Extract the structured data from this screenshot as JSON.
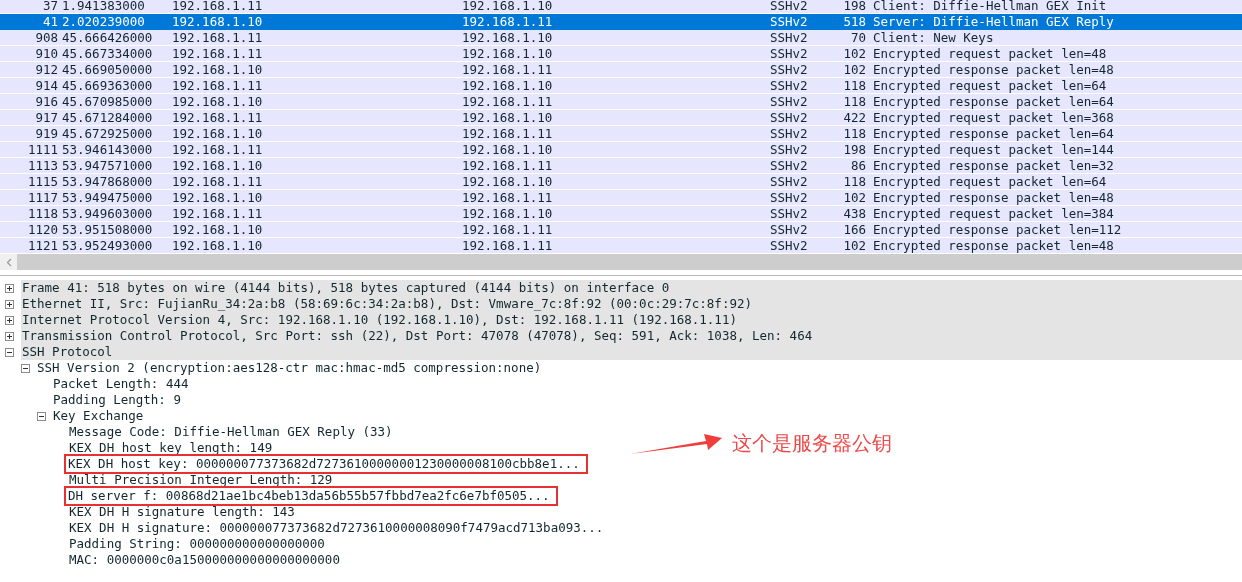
{
  "packet_list": {
    "rows": [
      {
        "no": "37",
        "time": "1.941383000",
        "source": "192.168.1.11",
        "destination": "192.168.1.10",
        "protocol": "SSHv2",
        "length": "198",
        "info": "Client: Diffie-Hellman GEX Init",
        "selected": false
      },
      {
        "no": "41",
        "time": "2.020239000",
        "source": "192.168.1.10",
        "destination": "192.168.1.11",
        "protocol": "SSHv2",
        "length": "518",
        "info": "Server: Diffie-Hellman GEX Reply",
        "selected": true
      },
      {
        "no": "908",
        "time": "45.666426000",
        "source": "192.168.1.11",
        "destination": "192.168.1.10",
        "protocol": "SSHv2",
        "length": "70",
        "info": "Client: New Keys",
        "selected": false
      },
      {
        "no": "910",
        "time": "45.667334000",
        "source": "192.168.1.11",
        "destination": "192.168.1.10",
        "protocol": "SSHv2",
        "length": "102",
        "info": "Encrypted request packet len=48",
        "selected": false
      },
      {
        "no": "912",
        "time": "45.669050000",
        "source": "192.168.1.10",
        "destination": "192.168.1.11",
        "protocol": "SSHv2",
        "length": "102",
        "info": "Encrypted response packet len=48",
        "selected": false
      },
      {
        "no": "914",
        "time": "45.669363000",
        "source": "192.168.1.11",
        "destination": "192.168.1.10",
        "protocol": "SSHv2",
        "length": "118",
        "info": "Encrypted request packet len=64",
        "selected": false
      },
      {
        "no": "916",
        "time": "45.670985000",
        "source": "192.168.1.10",
        "destination": "192.168.1.11",
        "protocol": "SSHv2",
        "length": "118",
        "info": "Encrypted response packet len=64",
        "selected": false
      },
      {
        "no": "917",
        "time": "45.671284000",
        "source": "192.168.1.11",
        "destination": "192.168.1.10",
        "protocol": "SSHv2",
        "length": "422",
        "info": "Encrypted request packet len=368",
        "selected": false
      },
      {
        "no": "919",
        "time": "45.672925000",
        "source": "192.168.1.10",
        "destination": "192.168.1.11",
        "protocol": "SSHv2",
        "length": "118",
        "info": "Encrypted response packet len=64",
        "selected": false
      },
      {
        "no": "1111",
        "time": "53.946143000",
        "source": "192.168.1.11",
        "destination": "192.168.1.10",
        "protocol": "SSHv2",
        "length": "198",
        "info": "Encrypted request packet len=144",
        "selected": false
      },
      {
        "no": "1113",
        "time": "53.947571000",
        "source": "192.168.1.10",
        "destination": "192.168.1.11",
        "protocol": "SSHv2",
        "length": "86",
        "info": "Encrypted response packet len=32",
        "selected": false
      },
      {
        "no": "1115",
        "time": "53.947868000",
        "source": "192.168.1.11",
        "destination": "192.168.1.10",
        "protocol": "SSHv2",
        "length": "118",
        "info": "Encrypted request packet len=64",
        "selected": false
      },
      {
        "no": "1117",
        "time": "53.949475000",
        "source": "192.168.1.10",
        "destination": "192.168.1.11",
        "protocol": "SSHv2",
        "length": "102",
        "info": "Encrypted response packet len=48",
        "selected": false
      },
      {
        "no": "1118",
        "time": "53.949603000",
        "source": "192.168.1.11",
        "destination": "192.168.1.10",
        "protocol": "SSHv2",
        "length": "438",
        "info": "Encrypted request packet len=384",
        "selected": false
      },
      {
        "no": "1120",
        "time": "53.951508000",
        "source": "192.168.1.10",
        "destination": "192.168.1.11",
        "protocol": "SSHv2",
        "length": "166",
        "info": "Encrypted response packet len=112",
        "selected": false
      },
      {
        "no": "1121",
        "time": "53.952493000",
        "source": "192.168.1.10",
        "destination": "192.168.1.11",
        "protocol": "SSHv2",
        "length": "102",
        "info": "Encrypted response packet len=48",
        "selected": false
      }
    ]
  },
  "packet_details": [
    {
      "text": "Frame 41: 518 bytes on wire (4144 bits), 518 bytes captured (4144 bits) on interface 0",
      "expanded": false
    },
    {
      "text": "Ethernet II, Src: FujianRu_34:2a:b8 (58:69:6c:34:2a:b8), Dst: Vmware_7c:8f:92 (00:0c:29:7c:8f:92)",
      "expanded": false
    },
    {
      "text": "Internet Protocol Version 4, Src: 192.168.1.10 (192.168.1.10), Dst: 192.168.1.11 (192.168.1.11)",
      "expanded": false
    },
    {
      "text": "Transmission Control Protocol, Src Port: ssh (22), Dst Port: 47078 (47078), Seq: 591, Ack: 1038, Len: 464",
      "expanded": false
    },
    {
      "text": "SSH Protocol",
      "expanded": true,
      "children": [
        {
          "text": "SSH Version 2 (encryption:aes128-ctr mac:hmac-md5 compression:none)",
          "expanded": true,
          "children": [
            {
              "text": "Packet Length: 444"
            },
            {
              "text": "Padding Length: 9"
            },
            {
              "text": "Key Exchange",
              "expanded": true,
              "children": [
                {
                  "text": "Message Code: Diffie-Hellman GEX Reply (33)"
                },
                {
                  "text": "KEX DH host key length: 149"
                },
                {
                  "text": "KEX DH host key: 000000077373682d72736100000001230000008100cbb8e1...",
                  "boxed": true
                },
                {
                  "text": "Multi Precision Integer Length: 129"
                },
                {
                  "text": "DH server f: 00868d21ae1bc4beb13da56b55b57fbbd7ea2fc6e7bf0505...",
                  "boxed": true
                },
                {
                  "text": "KEX DH H signature length: 143"
                },
                {
                  "text": "KEX DH H signature: 000000077373682d7273610000008090f7479acd713ba093..."
                },
                {
                  "text": "Padding String: 000000000000000000"
                },
                {
                  "text": "MAC: 0000000c0a150000000000000000000"
                }
              ]
            }
          ]
        }
      ]
    }
  ],
  "annotation": {
    "text": "这个是服务器公钥"
  }
}
